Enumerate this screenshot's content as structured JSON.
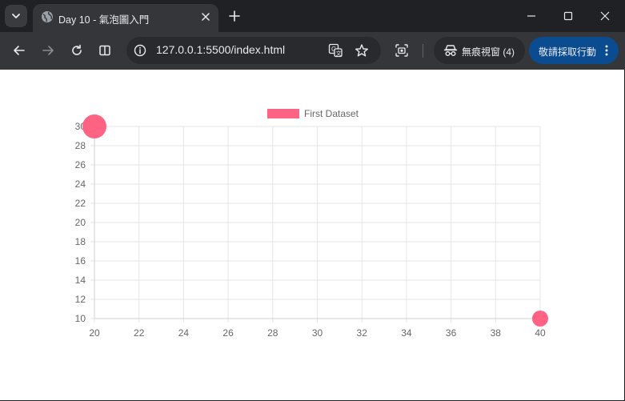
{
  "browser": {
    "tab_title": "Day 10 - 氣泡圖入門",
    "url": "127.0.0.1:5500/index.html",
    "incognito_label": "無痕視窗 (4)",
    "action_label": "敬請採取行動"
  },
  "colors": {
    "bubble_fill": "#ff6384",
    "grid": "#e5e5e5",
    "tick_text": "#666666"
  },
  "chart_data": {
    "type": "scatter",
    "subtype": "bubble",
    "legend_position": "top",
    "grid": true,
    "xlim": [
      20,
      40
    ],
    "ylim": [
      10,
      30
    ],
    "x_ticks": [
      "20",
      "22",
      "24",
      "26",
      "28",
      "30",
      "32",
      "34",
      "36",
      "38",
      "40"
    ],
    "y_ticks": [
      "10",
      "12",
      "14",
      "16",
      "18",
      "20",
      "22",
      "24",
      "26",
      "28",
      "30"
    ],
    "series": [
      {
        "name": "First Dataset",
        "color": "#ff6384",
        "points": [
          {
            "x": 20,
            "y": 30,
            "r": 15
          },
          {
            "x": 40,
            "y": 10,
            "r": 10
          }
        ]
      }
    ]
  }
}
